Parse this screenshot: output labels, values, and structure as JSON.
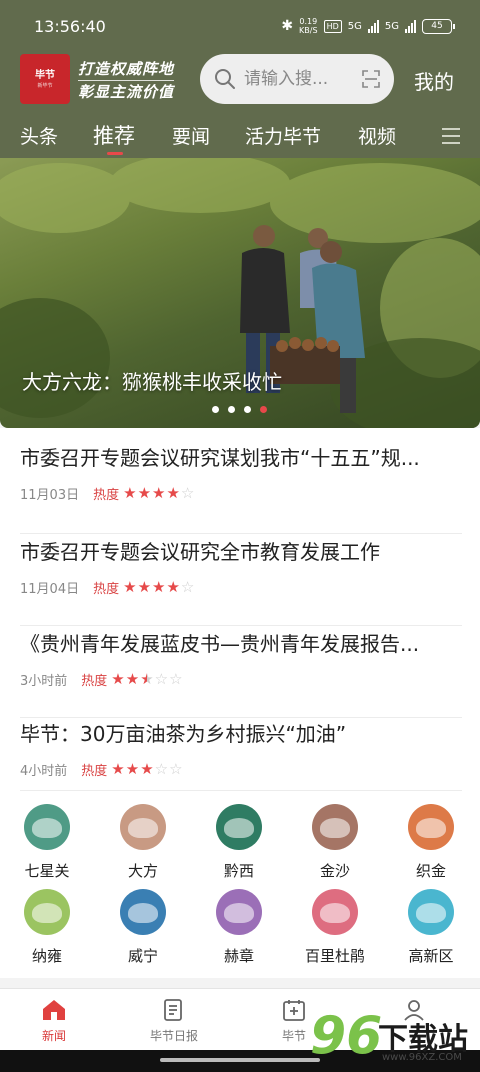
{
  "status": {
    "time": "13:56:40",
    "net_speed_value": "0.19",
    "net_speed_unit": "KB/S",
    "hd_label": "HD",
    "signal_1": "5G",
    "signal_2": "5G",
    "battery": "45"
  },
  "header": {
    "logo_title": "毕节",
    "logo_sub": "新毕节",
    "slogan_line1": "打造权威阵地",
    "slogan_line2": "彰显主流价值",
    "search_placeholder": "请输入搜...",
    "mine_label": "我的"
  },
  "nav": {
    "tabs": [
      "头条",
      "推荐",
      "要闻",
      "活力毕节",
      "视频"
    ],
    "active_index": 1
  },
  "banner": {
    "caption": "大方六龙：猕猴桃丰收采收忙",
    "slide_count": 4,
    "active_slide": 3
  },
  "news": [
    {
      "title": "市委召开专题会议研究谋划我市“十五五”规...",
      "date": "11月03日",
      "heat_label": "热度",
      "rating": 4
    },
    {
      "title": "市委召开专题会议研究全市教育发展工作",
      "date": "11月04日",
      "heat_label": "热度",
      "rating": 4
    },
    {
      "title": "《贵州青年发展蓝皮书—贵州青年发展报告...",
      "date": "3小时前",
      "heat_label": "热度",
      "rating": 2.5
    },
    {
      "title": "毕节：30万亩油茶为乡村振兴“加油”",
      "date": "4小时前",
      "heat_label": "热度",
      "rating": 3
    }
  ],
  "districts": [
    {
      "label": "七星关",
      "color": "#4f9b86"
    },
    {
      "label": "大方",
      "color": "#c89a83"
    },
    {
      "label": "黔西",
      "color": "#2f7c63"
    },
    {
      "label": "金沙",
      "color": "#a57565"
    },
    {
      "label": "织金",
      "color": "#dd7a48"
    },
    {
      "label": "纳雍",
      "color": "#9bc461"
    },
    {
      "label": "威宁",
      "color": "#3a7fb3"
    },
    {
      "label": "赫章",
      "color": "#9b6fb7"
    },
    {
      "label": "百里杜鹃",
      "color": "#de6d80"
    },
    {
      "label": "高新区",
      "color": "#4ab6cf"
    }
  ],
  "tabbar": {
    "items": [
      "新闻",
      "毕节日报",
      "毕节",
      ""
    ],
    "active_index": 0
  },
  "watermark": {
    "number": "96",
    "text": "下载站",
    "url": "www.96XZ.COM"
  },
  "colors": {
    "header_bg": "#616b4d",
    "accent_red": "#e8484a",
    "star_red": "#e64a4a"
  }
}
